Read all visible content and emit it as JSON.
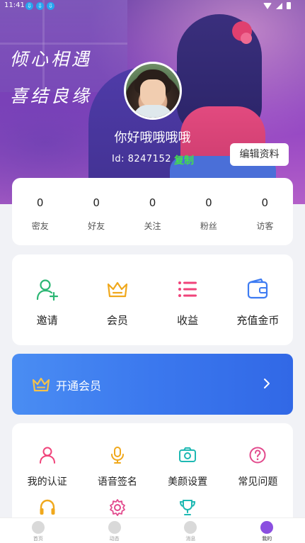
{
  "status_bar": {
    "time": "11:41",
    "download_badges": [
      "⇩",
      "⇩",
      "⇩"
    ]
  },
  "hero": {
    "slogan_line1": "倾心相遇",
    "slogan_line2": "喜结良缘",
    "nickname": "你好哦哦哦哦",
    "id_label": "Id: 8247152",
    "copy_label": "复制",
    "edit_label": "编辑资料"
  },
  "stats": [
    {
      "value": "0",
      "label": "密友"
    },
    {
      "value": "0",
      "label": "好友"
    },
    {
      "value": "0",
      "label": "关注"
    },
    {
      "value": "0",
      "label": "粉丝"
    },
    {
      "value": "0",
      "label": "访客"
    }
  ],
  "quick_actions": [
    {
      "label": "邀请",
      "icon": "add-user-icon",
      "color": "#2bb673"
    },
    {
      "label": "会员",
      "icon": "crown-icon",
      "color": "#f0a81c"
    },
    {
      "label": "收益",
      "icon": "list-icon",
      "color": "#f0437a"
    },
    {
      "label": "充值金币",
      "icon": "wallet-icon",
      "color": "#3d7bf2"
    }
  ],
  "vip_banner": {
    "label": "开通会员",
    "icon": "crown-icon",
    "color": "#f5c24a"
  },
  "services": [
    {
      "label": "我的认证",
      "icon": "user-icon",
      "color": "#f0437a"
    },
    {
      "label": "语音签名",
      "icon": "microphone-icon",
      "color": "#f0a81c"
    },
    {
      "label": "美颜设置",
      "icon": "camera-icon",
      "color": "#1fb9b3"
    },
    {
      "label": "常见问题",
      "icon": "question-icon",
      "color": "#e24a8d"
    },
    {
      "label": "",
      "icon": "headphones-icon",
      "color": "#f0a81c"
    },
    {
      "label": "",
      "icon": "settings-icon",
      "color": "#e24a8d"
    },
    {
      "label": "",
      "icon": "trophy-icon",
      "color": "#1fb9b3"
    }
  ],
  "tabbar": [
    {
      "label": "首页",
      "icon": "home-icon",
      "active": false
    },
    {
      "label": "动态",
      "icon": "moments-icon",
      "active": false
    },
    {
      "label": "消息",
      "icon": "message-icon",
      "active": false
    },
    {
      "label": "我的",
      "icon": "me-icon",
      "active": true
    }
  ],
  "colors": {
    "vip_gradient_start": "#4a8df3",
    "vip_gradient_end": "#3168e6",
    "copy_green": "#43e04a",
    "active_tab": "#8b4fe0"
  }
}
